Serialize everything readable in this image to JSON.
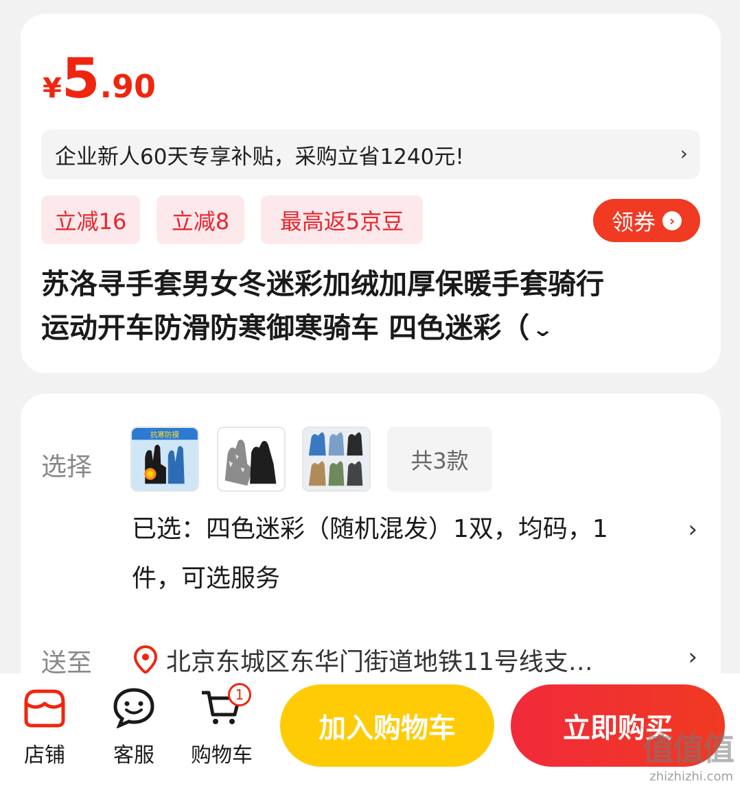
{
  "price": {
    "symbol": "¥",
    "integer": "5",
    "decimal": ".90"
  },
  "subsidy": {
    "text": "企业新人60天专享补贴，采购立省1240元!",
    "chevron": "›"
  },
  "tags": [
    "立减16",
    "立减8",
    "最高返5京豆"
  ],
  "coupon": {
    "label": "领券",
    "icon": "›"
  },
  "product": {
    "title_line1": "苏洛寻手套男女冬迷彩加绒加厚保暖手套骑行",
    "title_line2": "运动开车防滑防寒御寒骑车 四色迷彩（",
    "expand_icon": "chevron-down-icon"
  },
  "options": {
    "select_label": "选择",
    "variant_count": "共3款",
    "selected_text": "已选：四色迷彩（随机混发）1双，均码，1件，可选服务",
    "ship_label": "送至",
    "address": "北京东城区东华门街道地铁11号线支…"
  },
  "bottom_bar": {
    "store": "店铺",
    "service": "客服",
    "cart": "购物车",
    "cart_badge": "1",
    "add_to_cart": "加入购物车",
    "buy_now": "立即购买"
  },
  "watermark": {
    "big": "值值值",
    "small": "zhizhizhi.com"
  },
  "colors": {
    "accent": "#f0250f",
    "cart_button": "#ffcb05",
    "buy_button": "#f12a3a"
  }
}
